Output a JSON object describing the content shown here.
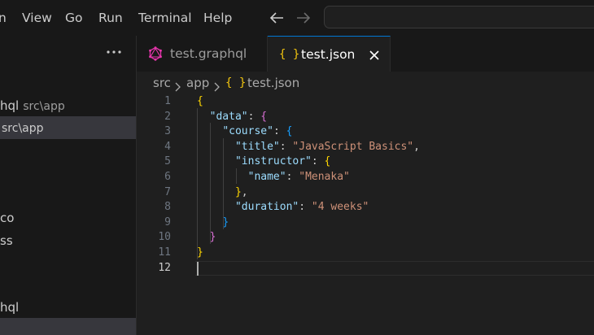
{
  "menu": {
    "items": [
      "n",
      "View",
      "Go",
      "Run",
      "Terminal",
      "Help"
    ]
  },
  "sidebar": {
    "more_label": "···",
    "items": [
      {
        "name": "hql",
        "desc": "src\\app",
        "selected": false
      },
      {
        "name": "",
        "desc": "src\\app",
        "selected": true
      },
      {
        "name": "co",
        "desc": "",
        "selected": false
      },
      {
        "name": "ss",
        "desc": "",
        "selected": false
      },
      {
        "name": "hql",
        "desc": "",
        "selected": false
      },
      {
        "name": "",
        "desc": "",
        "selected": true
      }
    ]
  },
  "tabs": [
    {
      "label": "test.graphql",
      "icon": "graphql-icon",
      "active": false
    },
    {
      "label": "test.json",
      "icon": "json-braces-icon",
      "active": true
    }
  ],
  "breadcrumb": {
    "items": [
      "src",
      "app",
      "test.json"
    ],
    "file_icon": "{ }"
  },
  "editor": {
    "line_numbers": [
      "1",
      "2",
      "3",
      "4",
      "5",
      "6",
      "7",
      "8",
      "9",
      "10",
      "11",
      "12"
    ],
    "lines": [
      [
        {
          "t": "{",
          "c": "#ffd700"
        }
      ],
      [
        {
          "t": "  "
        },
        {
          "t": "\"data\"",
          "c": "#9cdcfe"
        },
        {
          "t": ": ",
          "c": "#cccccc"
        },
        {
          "t": "{",
          "c": "#da70d6"
        }
      ],
      [
        {
          "t": "    "
        },
        {
          "t": "\"course\"",
          "c": "#9cdcfe"
        },
        {
          "t": ": ",
          "c": "#cccccc"
        },
        {
          "t": "{",
          "c": "#179fff"
        }
      ],
      [
        {
          "t": "      "
        },
        {
          "t": "\"title\"",
          "c": "#9cdcfe"
        },
        {
          "t": ": ",
          "c": "#cccccc"
        },
        {
          "t": "\"JavaScript Basics\"",
          "c": "#ce9178"
        },
        {
          "t": ",",
          "c": "#cccccc"
        }
      ],
      [
        {
          "t": "      "
        },
        {
          "t": "\"instructor\"",
          "c": "#9cdcfe"
        },
        {
          "t": ": ",
          "c": "#cccccc"
        },
        {
          "t": "{",
          "c": "#ffd700"
        }
      ],
      [
        {
          "t": "        "
        },
        {
          "t": "\"name\"",
          "c": "#9cdcfe"
        },
        {
          "t": ": ",
          "c": "#cccccc"
        },
        {
          "t": "\"Menaka\"",
          "c": "#ce9178"
        }
      ],
      [
        {
          "t": "      "
        },
        {
          "t": "}",
          "c": "#ffd700"
        },
        {
          "t": ",",
          "c": "#cccccc"
        }
      ],
      [
        {
          "t": "      "
        },
        {
          "t": "\"duration\"",
          "c": "#9cdcfe"
        },
        {
          "t": ": ",
          "c": "#cccccc"
        },
        {
          "t": "\"4 weeks\"",
          "c": "#ce9178"
        }
      ],
      [
        {
          "t": "    "
        },
        {
          "t": "}",
          "c": "#179fff"
        }
      ],
      [
        {
          "t": "  "
        },
        {
          "t": "}",
          "c": "#da70d6"
        }
      ],
      [
        {
          "t": "}",
          "c": "#ffd700"
        }
      ],
      []
    ],
    "current_line": "12"
  },
  "colors": {
    "accent": "#0078d4",
    "graphql": "#e535ab",
    "json_icon": "#f1c40f"
  }
}
